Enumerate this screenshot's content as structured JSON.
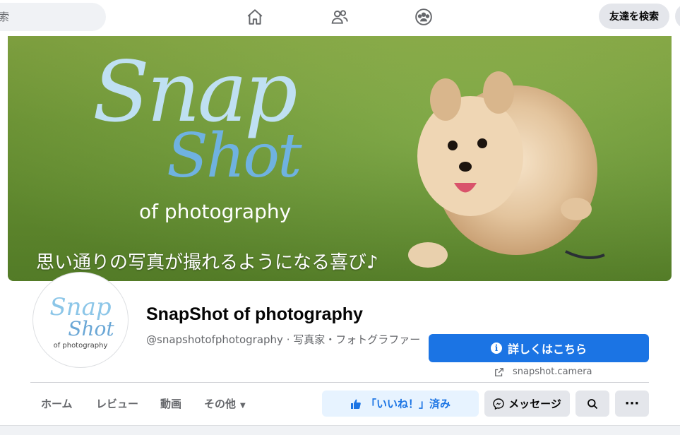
{
  "topbar": {
    "search_placeholder": "索",
    "nav_icons": [
      "home-icon",
      "friends-icon",
      "groups-icon"
    ],
    "friend_search_label": "友達を検索"
  },
  "cover": {
    "logo_snap": "Snap",
    "logo_shot": "Shot",
    "logo_sub": "of photography",
    "tagline": "思い通りの写真が撮れるようになる喜び♪",
    "colors": {
      "grass": "#78a43a",
      "logo_light": "#bfe0f2",
      "logo_dark": "#6fb2e0"
    }
  },
  "avatar": {
    "snap": "Snap",
    "shot": "Shot",
    "sub": "of photography"
  },
  "profile": {
    "name": "SnapShot of photography",
    "subtitle": "@snapshotofphotography · 写真家・フォトグラファー"
  },
  "actions": {
    "info_label": "詳しくはこちら",
    "website": "snapshot.camera",
    "like_label": "「いいね！」済み",
    "message_label": "メッセージ",
    "more_label": "···"
  },
  "tabs": [
    {
      "label": "ホーム"
    },
    {
      "label": "レビュー"
    },
    {
      "label": "動画"
    },
    {
      "label": "その他"
    }
  ],
  "colors": {
    "accent": "#1b74e4",
    "accent_light": "#e7f3ff",
    "button_grey": "#e4e6eb",
    "text_secondary": "#65676b"
  }
}
